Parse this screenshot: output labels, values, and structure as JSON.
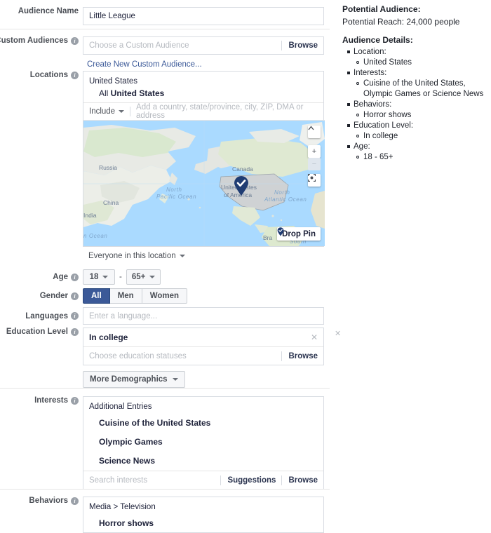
{
  "form": {
    "audience_name": {
      "label": "Audience Name",
      "value": "Little League"
    },
    "custom_audiences": {
      "label": "Custom Audiences",
      "placeholder": "Choose a Custom Audience",
      "browse_label": "Browse",
      "create_link": "Create New Custom Audience..."
    },
    "locations": {
      "label": "Locations",
      "country_header": "United States",
      "selected_prefix": "All ",
      "selected_bold": "United States",
      "include_label": "Include",
      "search_placeholder": "Add a country, state/province, city, ZIP, DMA or address",
      "everyone_label": "Everyone in this location",
      "drop_pin_label": "Drop Pin",
      "map_labels": [
        "Russia",
        "China",
        "India",
        "Canada",
        "United States",
        "of America",
        "North",
        "Pacific Ocean",
        "North",
        "Atlantic Ocean",
        "Bra",
        "South",
        "n Ocean"
      ]
    },
    "age": {
      "label": "Age",
      "min": "18",
      "max": "65+",
      "separator": "-"
    },
    "gender": {
      "label": "Gender",
      "options": [
        "All",
        "Men",
        "Women"
      ],
      "selected": "All"
    },
    "languages": {
      "label": "Languages",
      "placeholder": "Enter a language..."
    },
    "education_level": {
      "label": "Education Level",
      "selected": "In college",
      "placeholder": "Choose education statuses",
      "browse_label": "Browse",
      "more_demographics_label": "More Demographics"
    },
    "interests": {
      "label": "Interests",
      "group_header": "Additional Entries",
      "items": [
        "Cuisine of the United States",
        "Olympic Games",
        "Science News"
      ],
      "placeholder": "Search interests",
      "suggestions_label": "Suggestions",
      "browse_label": "Browse"
    },
    "behaviors": {
      "label": "Behaviors",
      "group_header": "Media > Television",
      "items": [
        "Horror shows"
      ]
    }
  },
  "sidebar": {
    "potential_audience_title": "Potential Audience:",
    "potential_reach": "Potential Reach: 24,000 people",
    "audience_details_title": "Audience Details:",
    "details": [
      {
        "label": "Location:",
        "values": [
          "United States"
        ]
      },
      {
        "label": "Interests:",
        "values": [
          "Cuisine of the United States, Olympic Games or Science News"
        ]
      },
      {
        "label": "Behaviors:",
        "values": [
          "Horror shows"
        ]
      },
      {
        "label": "Education Level:",
        "values": [
          "In college"
        ]
      },
      {
        "label": "Age:",
        "values": [
          "18 - 65+"
        ]
      }
    ]
  },
  "colors": {
    "facebook_blue": "#3b5998",
    "link_blue": "#3b5998",
    "map_water": "#aadaff"
  }
}
